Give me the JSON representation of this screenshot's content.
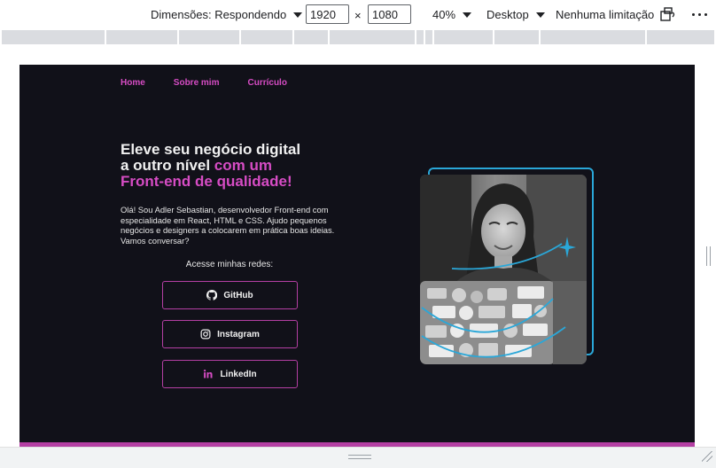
{
  "devtools": {
    "dimensions_label": "Dimensões: Respondendo",
    "width_value": "1920",
    "times_sign": "×",
    "height_value": "1080",
    "zoom": "40%",
    "device_type": "Desktop",
    "throttling": "Nenhuma limitação"
  },
  "page": {
    "nav": [
      "Home",
      "Sobre mim",
      "Currículo"
    ],
    "headline_line1": "Eleve seu negócio digital",
    "headline_line2_a": "a outro nível",
    "headline_line2_b": " com um",
    "headline_line3": "Front-end de qualidade!",
    "intro": "Olá! Sou Adler Sebastian, desenvolvedor Front-end com especialidade em React, HTML e CSS. Ajudo pequenos negócios e designers a colocarem em prática boas ideias. Vamos conversar?",
    "social_title": "Acesse minhas redes:",
    "social_links": [
      {
        "label": "GitHub",
        "icon": "github-icon"
      },
      {
        "label": "Instagram",
        "icon": "instagram-icon"
      },
      {
        "label": "LinkedIn",
        "icon": "linkedin-icon"
      }
    ],
    "colors": {
      "background": "#111119",
      "accent_pink": "#d64cc4",
      "frame_blue": "#2aa7d8"
    }
  }
}
